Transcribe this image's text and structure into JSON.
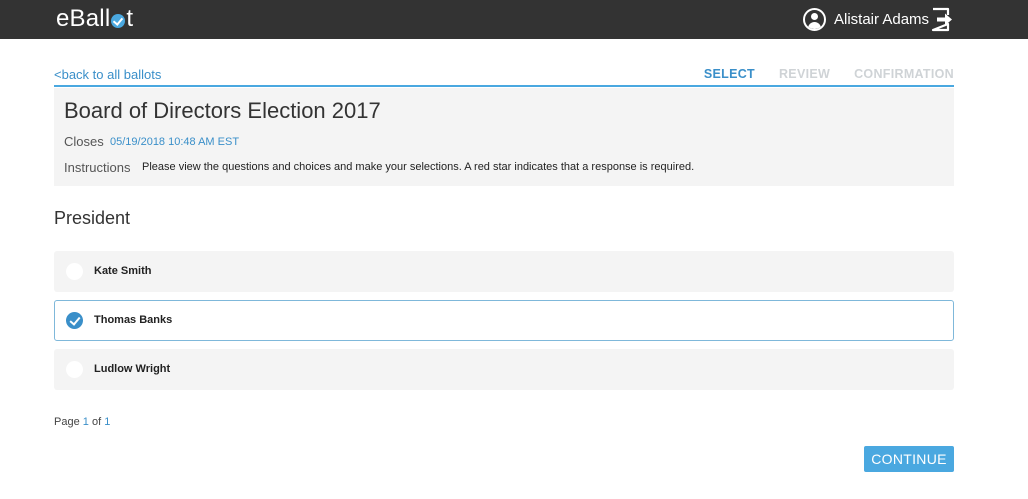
{
  "brand": {
    "logo_prefix": "eBall",
    "logo_suffix": "t",
    "logo_check_icon": "check-circle-icon",
    "accent_color": "#4aa8e0"
  },
  "user": {
    "name": "Alistair Adams",
    "avatar_icon": "user-circle-icon",
    "logout_icon": "logout-icon"
  },
  "nav": {
    "back_link": "<back to all ballots",
    "steps": {
      "select": "SELECT",
      "review": "REVIEW",
      "confirmation": "CONFIRMATION"
    },
    "active_step": "SELECT"
  },
  "ballot": {
    "title": "Board of Directors Election 2017",
    "closes_label": "Closes",
    "closes_value": "05/19/2018 10:48 AM EST",
    "instructions_label": "Instructions",
    "instructions_text": "Please view the questions and choices and make your selections. A red star indicates that a response is required."
  },
  "question": {
    "title": "President",
    "choices": [
      {
        "label": "Kate Smith",
        "selected": false
      },
      {
        "label": "Thomas Banks",
        "selected": true
      },
      {
        "label": "Ludlow Wright",
        "selected": false
      }
    ]
  },
  "pager": {
    "prefix": "Page",
    "current": "1",
    "of": "of",
    "total": "1"
  },
  "actions": {
    "continue_label": "CONTINUE"
  }
}
